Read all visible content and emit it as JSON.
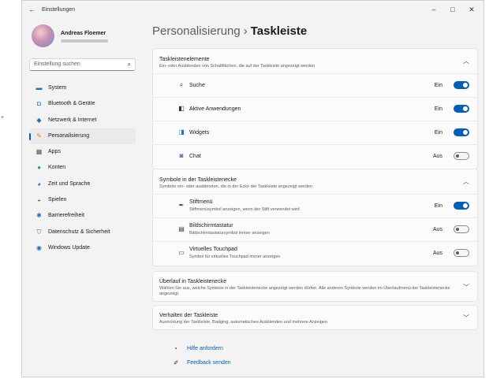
{
  "window": {
    "title": "Einstellungen"
  },
  "profile": {
    "name": "Andreas Floemer"
  },
  "search": {
    "placeholder": "Einstellung suchen"
  },
  "nav": [
    {
      "label": "System",
      "icon": "monitor-icon",
      "color": "#1a73c8"
    },
    {
      "label": "Bluetooth & Geräte",
      "icon": "bluetooth-icon",
      "color": "#1a73c8"
    },
    {
      "label": "Netzwerk & Internet",
      "icon": "wifi-icon",
      "color": "#1a73c8"
    },
    {
      "label": "Personalisierung",
      "icon": "pen-icon",
      "color": "#d9822b",
      "selected": true
    },
    {
      "label": "Apps",
      "icon": "apps-icon",
      "color": "#555555"
    },
    {
      "label": "Konten",
      "icon": "person-icon",
      "color": "#1fa37a"
    },
    {
      "label": "Zeit und Sprache",
      "icon": "globe-clock-icon",
      "color": "#1a73c8"
    },
    {
      "label": "Spielen",
      "icon": "gamepad-icon",
      "color": "#666666"
    },
    {
      "label": "Barrierefreiheit",
      "icon": "accessibility-icon",
      "color": "#1a73c8"
    },
    {
      "label": "Datenschutz & Sicherheit",
      "icon": "shield-icon",
      "color": "#666666"
    },
    {
      "label": "Windows Update",
      "icon": "update-icon",
      "color": "#1a73c8"
    }
  ],
  "breadcrumb": {
    "parent": "Personalisierung",
    "separator": "›",
    "current": "Taskleiste"
  },
  "section1": {
    "title": "Taskleistenelemente",
    "subtitle": "Ein- oder Ausblenden von Schaltflächen, die auf der Taskleiste angezeigt werden",
    "rows": [
      {
        "label": "Suche",
        "state": "Ein",
        "on": true,
        "icon": "search-icon"
      },
      {
        "label": "Aktive Anwendungen",
        "state": "Ein",
        "on": true,
        "icon": "task-view-icon"
      },
      {
        "label": "Widgets",
        "state": "Ein",
        "on": true,
        "icon": "widgets-icon"
      },
      {
        "label": "Chat",
        "state": "Aus",
        "on": false,
        "icon": "chat-icon"
      }
    ]
  },
  "section2": {
    "title": "Symbole in der Taskleistenecke",
    "subtitle": "Symbole ein- oder ausblenden, die in der Ecke der Taskleiste angezeigt werden",
    "rows": [
      {
        "label": "Stiftmenü",
        "sub": "Stiftmenüsymbol anzeigen, wenn der Stift verwendet wird",
        "state": "Ein",
        "on": true,
        "icon": "pen-menu-icon"
      },
      {
        "label": "Bildschirmtastatur",
        "sub": "Bildschirmtastatursymbol immer anzeigen",
        "state": "Aus",
        "on": false,
        "icon": "keyboard-icon"
      },
      {
        "label": "Virtuelles Touchpad",
        "sub": "Symbol für virtuelles Touchpad immer anzeigen",
        "state": "Aus",
        "on": false,
        "icon": "touchpad-icon"
      }
    ]
  },
  "section3": {
    "title": "Überlauf in Taskleistenecke",
    "subtitle": "Wählen Sie aus, welche Symbole in der Taskleistenecke angezeigt werden dürfen. Alle anderen Symbole werden im Überlaufmenü der Taskleistenecke angezeigt."
  },
  "section4": {
    "title": "Verhalten der Taskleiste",
    "subtitle": "Ausrichtung der Taskleiste, Badging, automatisches Ausblenden und mehrere Anzeigen"
  },
  "links": {
    "help": "Hilfe anfordern",
    "feedback": "Feedback senden"
  },
  "colors": {
    "accent": "#005fb8"
  }
}
